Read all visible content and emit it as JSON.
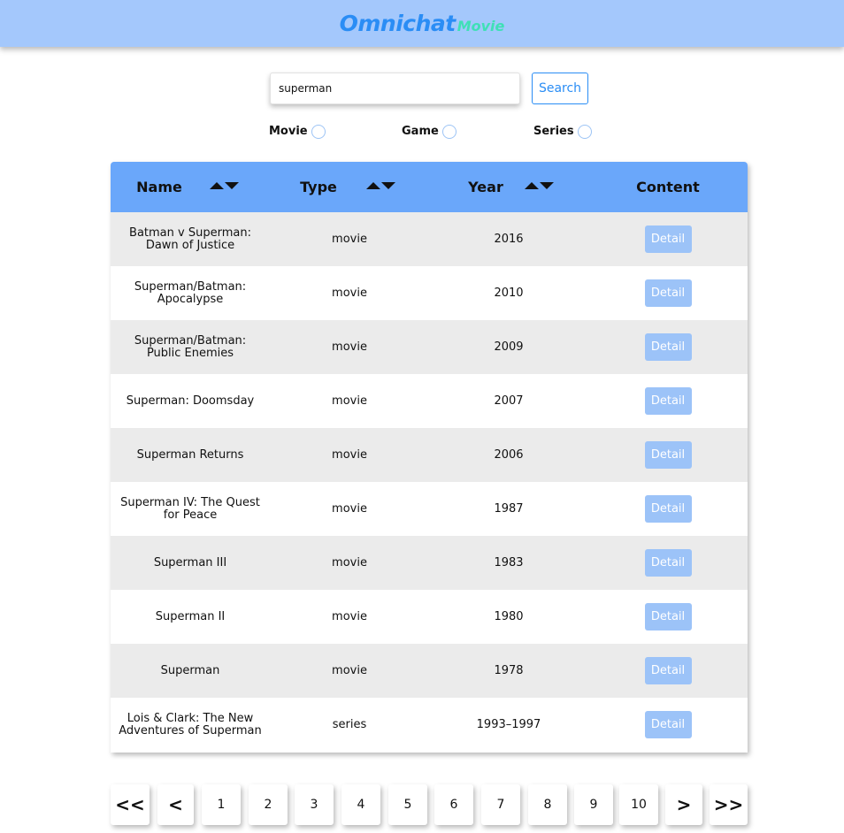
{
  "header": {
    "logo_main": "Omnichat",
    "logo_sub": "Movie"
  },
  "search": {
    "value": "superman",
    "button_label": "Search"
  },
  "filters": [
    {
      "label": "Movie"
    },
    {
      "label": "Game"
    },
    {
      "label": "Series"
    }
  ],
  "table": {
    "columns": [
      "Name",
      "Type",
      "Year",
      "Content"
    ],
    "rows": [
      {
        "name": "Batman v Superman: Dawn of Justice",
        "type": "movie",
        "year": "2016",
        "action": "Detail"
      },
      {
        "name": "Superman/Batman: Apocalypse",
        "type": "movie",
        "year": "2010",
        "action": "Detail"
      },
      {
        "name": "Superman/Batman: Public Enemies",
        "type": "movie",
        "year": "2009",
        "action": "Detail"
      },
      {
        "name": "Superman: Doomsday",
        "type": "movie",
        "year": "2007",
        "action": "Detail"
      },
      {
        "name": "Superman Returns",
        "type": "movie",
        "year": "2006",
        "action": "Detail"
      },
      {
        "name": "Superman IV: The Quest for Peace",
        "type": "movie",
        "year": "1987",
        "action": "Detail"
      },
      {
        "name": "Superman III",
        "type": "movie",
        "year": "1983",
        "action": "Detail"
      },
      {
        "name": "Superman II",
        "type": "movie",
        "year": "1980",
        "action": "Detail"
      },
      {
        "name": "Superman",
        "type": "movie",
        "year": "1978",
        "action": "Detail"
      },
      {
        "name": "Lois & Clark: The New Adventures of Superman",
        "type": "series",
        "year": "1993–1997",
        "action": "Detail"
      }
    ]
  },
  "pagination": {
    "first": "<<",
    "prev": "<",
    "pages": [
      "1",
      "2",
      "3",
      "4",
      "5",
      "6",
      "7",
      "8",
      "9",
      "10"
    ],
    "next": ">",
    "last": ">>"
  },
  "colors": {
    "header_bg": "#a4c8fc",
    "table_head_bg": "#6aa7fa",
    "accent": "#2a8df5",
    "detail_button": "#9cc3f8",
    "row_alt": "#ebebeb"
  }
}
